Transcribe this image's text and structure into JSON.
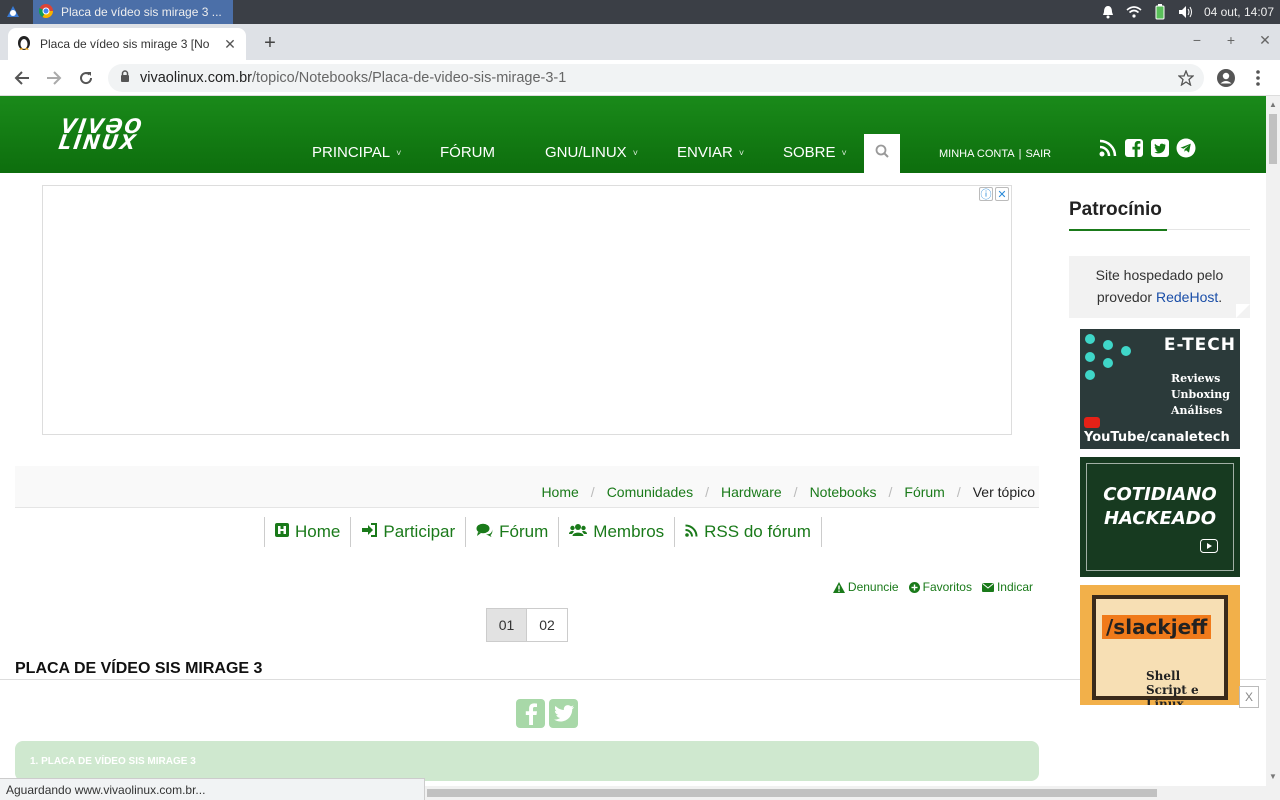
{
  "taskbar": {
    "window_title": "Placa de vídeo sis mirage 3 ...",
    "clock": "04 out, 14:07"
  },
  "browser": {
    "tab_title": "Placa de vídeo sis mirage 3 [No",
    "url_domain": "vivaolinux.com.br",
    "url_path": "/topico/Notebooks/Placa-de-video-sis-mirage-3-1"
  },
  "site": {
    "logo_line1": "VIVƏO",
    "logo_line2": "LINUX",
    "nav": [
      {
        "label": "PRINCIPAL",
        "caret": "˅"
      },
      {
        "label": "FÓRUM",
        "caret": ""
      },
      {
        "label": "GNU/LINUX",
        "caret": "˅"
      },
      {
        "label": "ENVIAR",
        "caret": "˅"
      },
      {
        "label": "SOBRE",
        "caret": "˅"
      }
    ],
    "account": "MINHA CONTA",
    "account_sep": "|",
    "logout": "SAIR"
  },
  "breadcrumb": [
    "Home",
    "Comunidades",
    "Hardware",
    "Notebooks",
    "Fórum"
  ],
  "breadcrumb_sep": "/",
  "breadcrumb_current": "Ver tópico",
  "forum_nav": [
    "Home",
    "Participar",
    "Fórum",
    "Membros",
    "RSS do fórum"
  ],
  "actions": [
    "Denuncie",
    "Favoritos",
    "Indicar"
  ],
  "pages": [
    "01",
    "02"
  ],
  "topic_title": "PLACA DE VÍDEO SIS MIRAGE 3",
  "post_header": "1. PLACA DE VÍDEO SIS MIRAGE 3",
  "sidebar": {
    "title": "Patrocínio",
    "hosted_text": "Site hospedado pelo provedor",
    "hosted_link": "RedeHost",
    "hosted_end": ".",
    "banner1_brand": "E-TECH",
    "banner1_lines": [
      "Reviews",
      "Unboxing",
      "Análises"
    ],
    "banner1_channel": "YouTube/canaletech",
    "banner2_lines": [
      "COTIDIANO",
      "HACKEADO"
    ],
    "banner3_title": "/slackjeff",
    "banner3_sub": "Shell Script e Linux",
    "close_label": "X"
  },
  "status_text": "Aguardando www.vivaolinux.com.br..."
}
